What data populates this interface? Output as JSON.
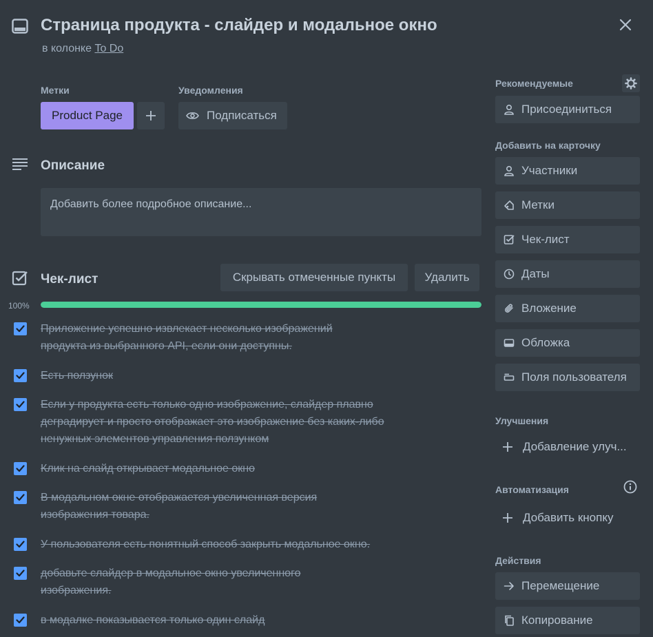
{
  "header": {
    "title": "Страница продукта - слайдер и модальное окно",
    "subtitle_prefix": "в колонке",
    "list_link": "To Do"
  },
  "labels_section": {
    "label": "Метки",
    "chip": "Product Page",
    "chip_color": "#9f8fef"
  },
  "notifications_section": {
    "label": "Уведомления",
    "watch_button": "Подписаться"
  },
  "description": {
    "heading": "Описание",
    "placeholder": "Добавить более подробное описание..."
  },
  "checklist": {
    "heading": "Чек-лист",
    "hide_button": "Скрывать отмеченные пункты",
    "delete_button": "Удалить",
    "progress_text": "100%",
    "progress": 1.0,
    "progress_color": "#4bce97",
    "items": [
      {
        "text": "Приложение успешно извлекает несколько изображений продукта из выбранного API, если они доступны.",
        "checked": true
      },
      {
        "text": "Есть ползунок",
        "checked": true
      },
      {
        "text": "Если у продукта есть только одно изображение, слайдер плавно деградирует и просто отображает это изображение без каких-либо ненужных элементов управления ползунком",
        "checked": true
      },
      {
        "text": "Клик на слайд открывает модальное окно",
        "checked": true
      },
      {
        "text": "В модальном окне отображается увеличенная версия изображения товара.",
        "checked": true
      },
      {
        "text": "У пользователя есть понятный способ закрыть модальное окно.",
        "checked": true
      },
      {
        "text": "добавьте слайдер в модальное окно увеличенного изображения.",
        "checked": true
      },
      {
        "text": "в модалке показывается только один слайд",
        "checked": true
      }
    ]
  },
  "sidebar": {
    "suggested": {
      "label": "Рекомендуемые",
      "join": "Присоединиться"
    },
    "add_to_card": {
      "label": "Добавить на карточку",
      "items": [
        {
          "label": "Участники",
          "icon": "person-icon"
        },
        {
          "label": "Метки",
          "icon": "tag-icon"
        },
        {
          "label": "Чек-лист",
          "icon": "checklist-icon"
        },
        {
          "label": "Даты",
          "icon": "clock-icon"
        },
        {
          "label": "Вложение",
          "icon": "paperclip-icon"
        },
        {
          "label": "Обложка",
          "icon": "cover-icon"
        },
        {
          "label": "Поля пользователя",
          "icon": "custom-fields-icon"
        }
      ]
    },
    "power_ups": {
      "label": "Улучшения",
      "add": "Добавление улуч..."
    },
    "automation": {
      "label": "Автоматизация",
      "add": "Добавить кнопку"
    },
    "actions": {
      "label": "Действия",
      "items": [
        {
          "label": "Перемещение",
          "icon": "arrow-right-icon"
        },
        {
          "label": "Копирование",
          "icon": "copy-icon"
        }
      ]
    }
  }
}
